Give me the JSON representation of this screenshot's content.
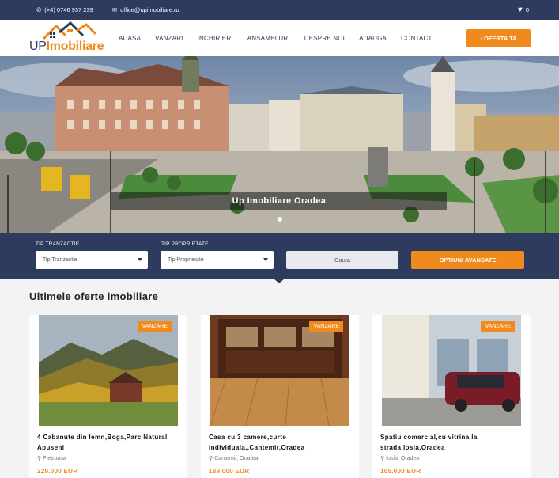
{
  "topbar": {
    "phone": "(+4) 0746 937 239",
    "email": "office@upimobiliare.ro",
    "favorites_count": "0"
  },
  "logo": {
    "up": "UP",
    "imobiliare": "Imobiliare"
  },
  "menu": [
    "ACASA",
    "VANZARI",
    "INCHIRIERI",
    "ANSAMBLURI",
    "DESPRE NOI",
    "ADAUGA",
    "CONTACT"
  ],
  "offer_button": "› OFERTA TA",
  "hero": {
    "caption": "Up Imobiliare Oradea"
  },
  "search": {
    "tranzactie_label": "TIP TRANZACTIE",
    "tranzactie_value": "Tip Tranzactie",
    "proprietate_label": "TIP PROPRIETATE",
    "proprietate_value": "Tip Proprietate",
    "search_button": "Cauta",
    "advanced_button": "OPTIUNI AVANSATE"
  },
  "listings_title": "Ultimele oferte imobiliare",
  "listings": [
    {
      "badge": "VANZARE",
      "title": "4 Cabanute din lemn,Boga,Parc Natural Apuseni",
      "location": "Pietroasa",
      "price": "229.000 EUR"
    },
    {
      "badge": "VANZARE",
      "title": "Casa cu 3 camere,curte individuala,,Cantemir,Oradea",
      "location": "Cantemir, Oradea",
      "price": "189.000 EUR"
    },
    {
      "badge": "VANZARE",
      "title": "Spatiu comercial,cu vitrina la strada,Iosia,Oradea",
      "location": "Iosia, Oradea",
      "price": "105.000 EUR"
    }
  ],
  "colors": {
    "navy": "#2c3b5e",
    "orange": "#f08a1c"
  }
}
